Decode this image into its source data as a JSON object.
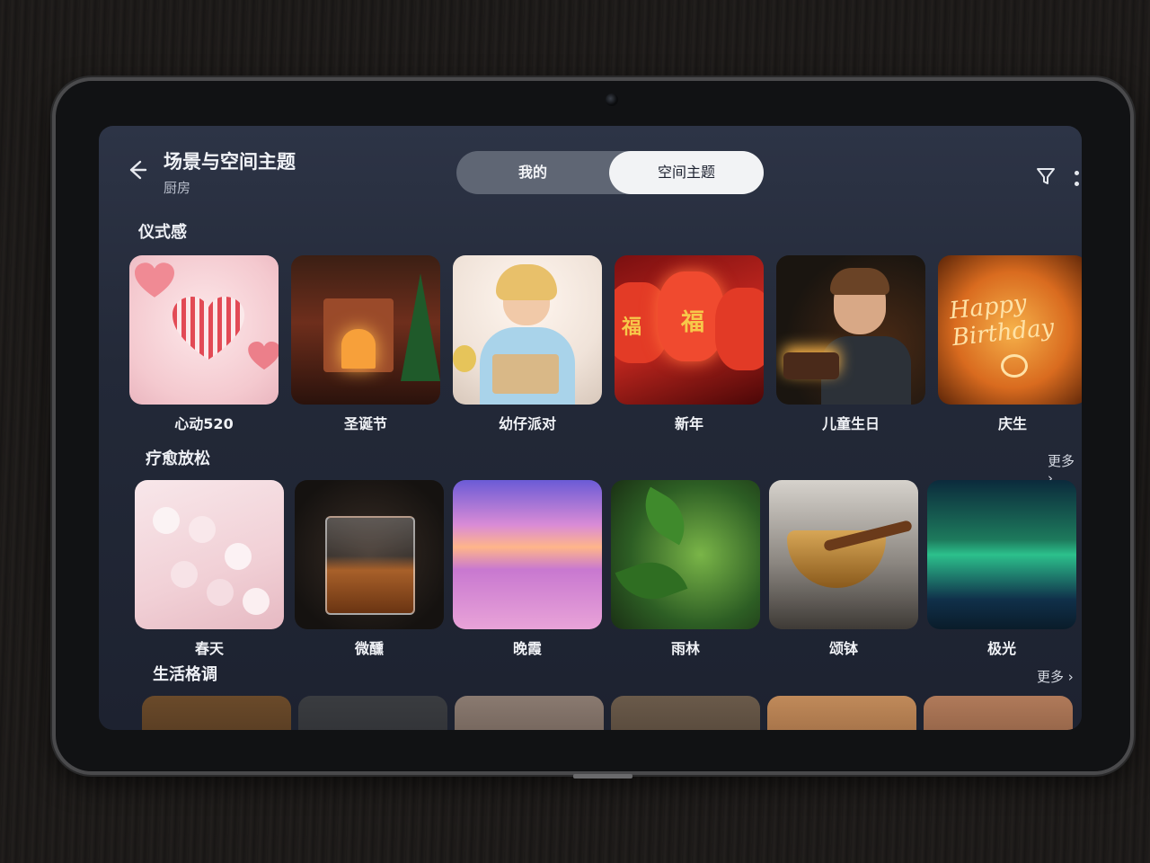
{
  "header": {
    "title": "场景与空间主题",
    "subtitle": "厨房",
    "tabs": [
      {
        "label": "我的",
        "selected": false
      },
      {
        "label": "空间主题",
        "selected": true
      }
    ]
  },
  "sections": [
    {
      "title": "仪式感",
      "more": "",
      "items": [
        "心动520",
        "圣诞节",
        "幼仔派对",
        "新年",
        "儿童生日",
        "庆生"
      ]
    },
    {
      "title": "疗愈放松",
      "more": "更多",
      "items": [
        "春天",
        "微醺",
        "晚霞",
        "雨林",
        "颂钵",
        "极光"
      ]
    },
    {
      "title": "生活格调",
      "more": "更多",
      "items": [
        "",
        "",
        "",
        "",
        "",
        ""
      ]
    }
  ],
  "icons": {
    "back": "back-arrow-icon",
    "filter": "filter-icon",
    "more": "more-grid-icon"
  },
  "colors": {
    "screen_bg": "#232938",
    "segment_selected_bg": "#f2f3f5",
    "segment_bg": "#5f6674"
  }
}
